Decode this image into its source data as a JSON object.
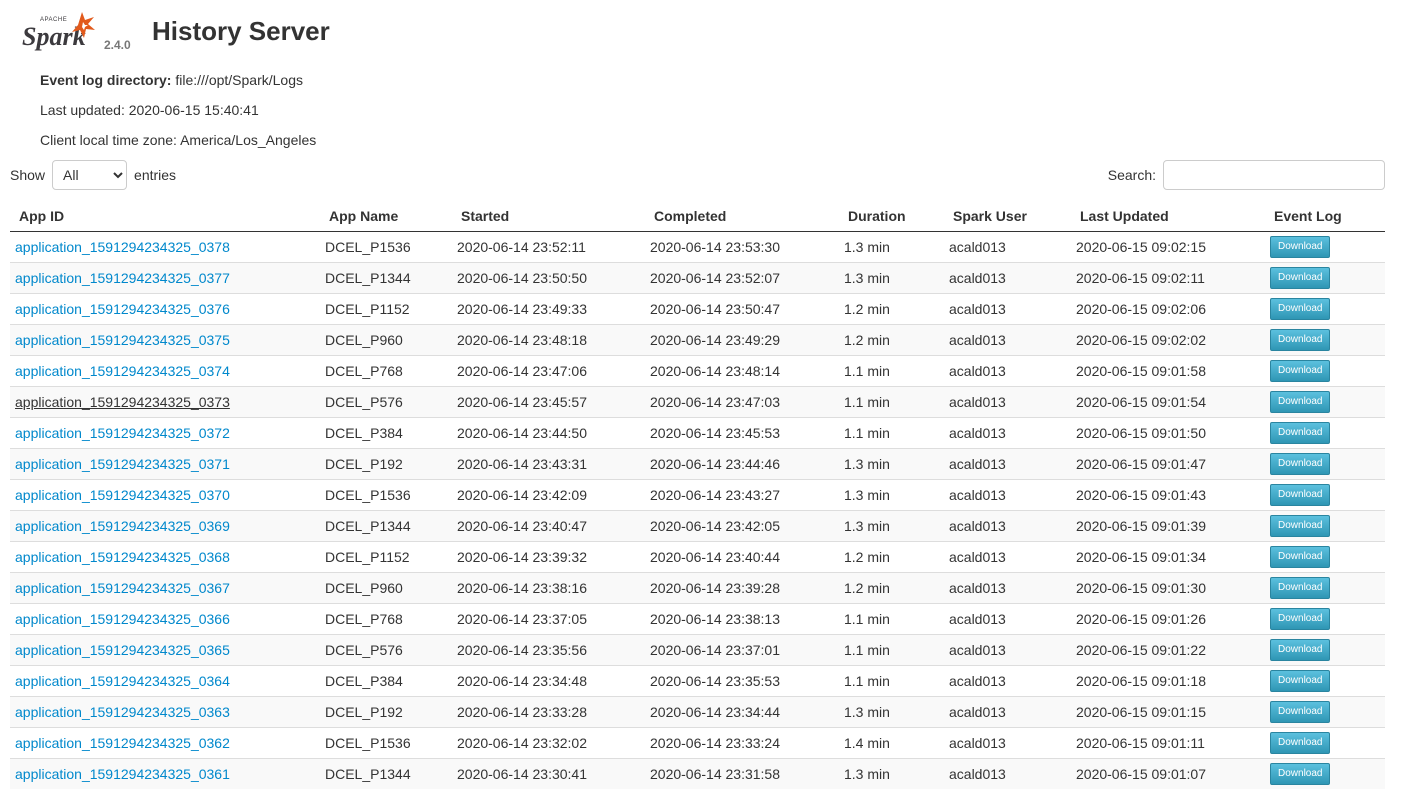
{
  "header": {
    "logo_text": "Apache Spark",
    "version": "2.4.0",
    "title": "History Server"
  },
  "info": {
    "event_log_label": "Event log directory:",
    "event_log_value": "file:///opt/Spark/Logs",
    "last_updated": "Last updated: 2020-06-15 15:40:41",
    "time_zone": "Client local time zone: America/Los_Angeles"
  },
  "controls": {
    "show_label": "Show",
    "show_value": "All",
    "entries_label": "entries",
    "search_label": "Search:",
    "search_value": ""
  },
  "table": {
    "columns": [
      "App ID",
      "App Name",
      "Started",
      "Completed",
      "Duration",
      "Spark User",
      "Last Updated",
      "Event Log"
    ],
    "download_label": "Download",
    "rows": [
      [
        "application_1591294234325_0378",
        "DCEL_P1536",
        "2020-06-14 23:52:11",
        "2020-06-14 23:53:30",
        "1.3 min",
        "acald013",
        "2020-06-15 09:02:15"
      ],
      [
        "application_1591294234325_0377",
        "DCEL_P1344",
        "2020-06-14 23:50:50",
        "2020-06-14 23:52:07",
        "1.3 min",
        "acald013",
        "2020-06-15 09:02:11"
      ],
      [
        "application_1591294234325_0376",
        "DCEL_P1152",
        "2020-06-14 23:49:33",
        "2020-06-14 23:50:47",
        "1.2 min",
        "acald013",
        "2020-06-15 09:02:06"
      ],
      [
        "application_1591294234325_0375",
        "DCEL_P960",
        "2020-06-14 23:48:18",
        "2020-06-14 23:49:29",
        "1.2 min",
        "acald013",
        "2020-06-15 09:02:02"
      ],
      [
        "application_1591294234325_0374",
        "DCEL_P768",
        "2020-06-14 23:47:06",
        "2020-06-14 23:48:14",
        "1.1 min",
        "acald013",
        "2020-06-15 09:01:58"
      ],
      [
        "application_1591294234325_0373",
        "DCEL_P576",
        "2020-06-14 23:45:57",
        "2020-06-14 23:47:03",
        "1.1 min",
        "acald013",
        "2020-06-15 09:01:54"
      ],
      [
        "application_1591294234325_0372",
        "DCEL_P384",
        "2020-06-14 23:44:50",
        "2020-06-14 23:45:53",
        "1.1 min",
        "acald013",
        "2020-06-15 09:01:50"
      ],
      [
        "application_1591294234325_0371",
        "DCEL_P192",
        "2020-06-14 23:43:31",
        "2020-06-14 23:44:46",
        "1.3 min",
        "acald013",
        "2020-06-15 09:01:47"
      ],
      [
        "application_1591294234325_0370",
        "DCEL_P1536",
        "2020-06-14 23:42:09",
        "2020-06-14 23:43:27",
        "1.3 min",
        "acald013",
        "2020-06-15 09:01:43"
      ],
      [
        "application_1591294234325_0369",
        "DCEL_P1344",
        "2020-06-14 23:40:47",
        "2020-06-14 23:42:05",
        "1.3 min",
        "acald013",
        "2020-06-15 09:01:39"
      ],
      [
        "application_1591294234325_0368",
        "DCEL_P1152",
        "2020-06-14 23:39:32",
        "2020-06-14 23:40:44",
        "1.2 min",
        "acald013",
        "2020-06-15 09:01:34"
      ],
      [
        "application_1591294234325_0367",
        "DCEL_P960",
        "2020-06-14 23:38:16",
        "2020-06-14 23:39:28",
        "1.2 min",
        "acald013",
        "2020-06-15 09:01:30"
      ],
      [
        "application_1591294234325_0366",
        "DCEL_P768",
        "2020-06-14 23:37:05",
        "2020-06-14 23:38:13",
        "1.1 min",
        "acald013",
        "2020-06-15 09:01:26"
      ],
      [
        "application_1591294234325_0365",
        "DCEL_P576",
        "2020-06-14 23:35:56",
        "2020-06-14 23:37:01",
        "1.1 min",
        "acald013",
        "2020-06-15 09:01:22"
      ],
      [
        "application_1591294234325_0364",
        "DCEL_P384",
        "2020-06-14 23:34:48",
        "2020-06-14 23:35:53",
        "1.1 min",
        "acald013",
        "2020-06-15 09:01:18"
      ],
      [
        "application_1591294234325_0363",
        "DCEL_P192",
        "2020-06-14 23:33:28",
        "2020-06-14 23:34:44",
        "1.3 min",
        "acald013",
        "2020-06-15 09:01:15"
      ],
      [
        "application_1591294234325_0362",
        "DCEL_P1536",
        "2020-06-14 23:32:02",
        "2020-06-14 23:33:24",
        "1.4 min",
        "acald013",
        "2020-06-15 09:01:11"
      ],
      [
        "application_1591294234325_0361",
        "DCEL_P1344",
        "2020-06-14 23:30:41",
        "2020-06-14 23:31:58",
        "1.3 min",
        "acald013",
        "2020-06-15 09:01:07"
      ]
    ],
    "hovered_row": 5
  },
  "colors": {
    "link": "#0088cc",
    "button": "#49afcd",
    "logo_orange": "#e25a1c",
    "logo_text": "#3c3a3e"
  }
}
